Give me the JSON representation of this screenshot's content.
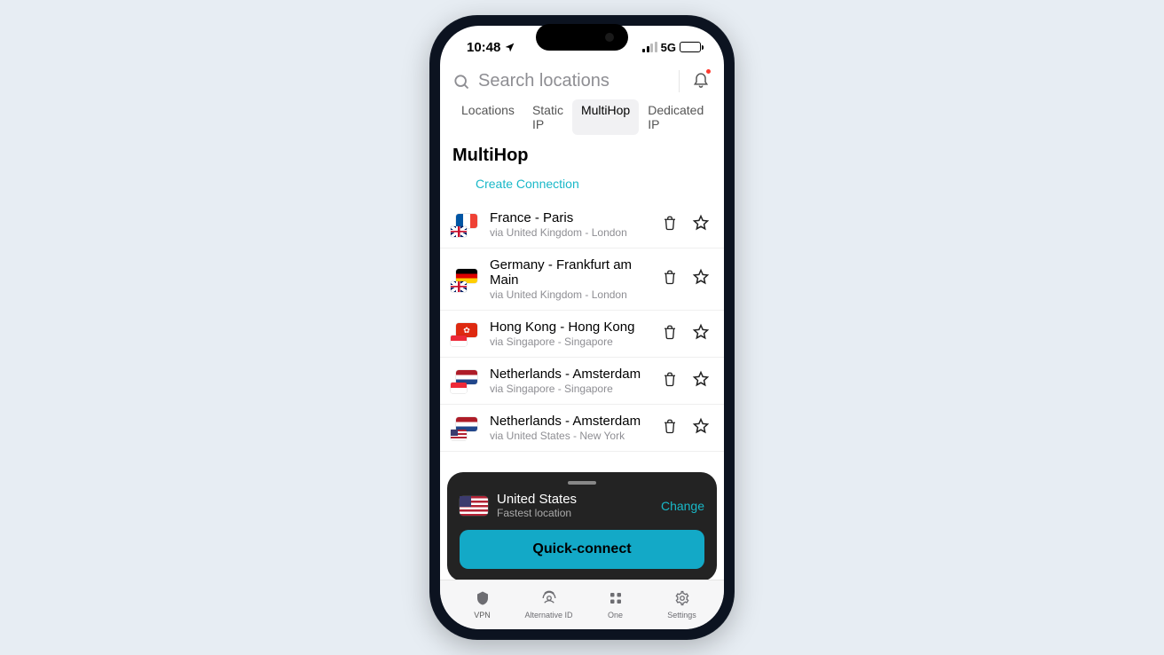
{
  "status": {
    "time": "10:48",
    "network": "5G"
  },
  "search": {
    "placeholder": "Search locations"
  },
  "tabs": {
    "items": [
      "Locations",
      "Static IP",
      "MultiHop",
      "Dedicated IP"
    ],
    "activeIndex": 2
  },
  "section": {
    "title": "MultiHop",
    "create": "Create Connection"
  },
  "connections": [
    {
      "title": "France - Paris",
      "via": "via United Kingdom - London",
      "mainFlag": "fr",
      "subFlag": "uk"
    },
    {
      "title": "Germany - Frankfurt am Main",
      "via": "via United Kingdom - London",
      "mainFlag": "de",
      "subFlag": "uk"
    },
    {
      "title": "Hong Kong - Hong Kong",
      "via": "via Singapore - Singapore",
      "mainFlag": "hk",
      "subFlag": "sg"
    },
    {
      "title": "Netherlands - Amsterdam",
      "via": "via Singapore - Singapore",
      "mainFlag": "nl",
      "subFlag": "sg"
    },
    {
      "title": "Netherlands - Amsterdam",
      "via": "via United States - New York",
      "mainFlag": "nl",
      "subFlag": "us"
    }
  ],
  "sheet": {
    "countryFlag": "us",
    "title": "United States",
    "subtitle": "Fastest location",
    "change": "Change",
    "button": "Quick-connect"
  },
  "tabbar": {
    "items": [
      "VPN",
      "Alternative ID",
      "One",
      "Settings"
    ]
  }
}
